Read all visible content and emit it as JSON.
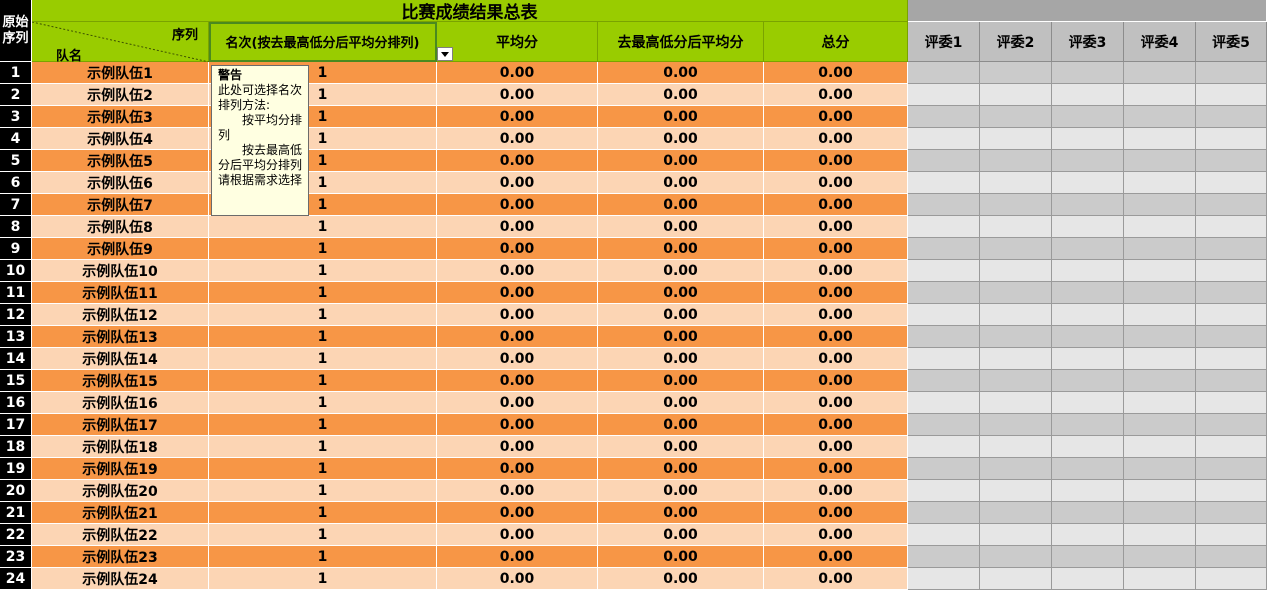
{
  "sheet": {
    "title": "比赛成绩结果总表",
    "corner_label": "原始序列",
    "diag_top": "序列",
    "diag_bottom": "队名",
    "headers": {
      "rank": "名次(按去最高低分后平均分排列)",
      "avg": "平均分",
      "trim_avg": "去最高低分后平均分",
      "total": "总分",
      "judges": [
        "评委1",
        "评委2",
        "评委3",
        "评委4",
        "评委5"
      ]
    },
    "tooltip": {
      "title": "警告",
      "lines": [
        "此处可选择名次排列方法:",
        "　　按平均分排列",
        "　　按去最高低分后平均分排列",
        "请根据需求选择"
      ]
    },
    "rows": [
      {
        "num": "1",
        "team": "示例队伍1",
        "rank": "1",
        "avg": "0.00",
        "trim": "0.00",
        "total": "0.00"
      },
      {
        "num": "2",
        "team": "示例队伍2",
        "rank": "1",
        "avg": "0.00",
        "trim": "0.00",
        "total": "0.00"
      },
      {
        "num": "3",
        "team": "示例队伍3",
        "rank": "1",
        "avg": "0.00",
        "trim": "0.00",
        "total": "0.00"
      },
      {
        "num": "4",
        "team": "示例队伍4",
        "rank": "1",
        "avg": "0.00",
        "trim": "0.00",
        "total": "0.00"
      },
      {
        "num": "5",
        "team": "示例队伍5",
        "rank": "1",
        "avg": "0.00",
        "trim": "0.00",
        "total": "0.00"
      },
      {
        "num": "6",
        "team": "示例队伍6",
        "rank": "1",
        "avg": "0.00",
        "trim": "0.00",
        "total": "0.00"
      },
      {
        "num": "7",
        "team": "示例队伍7",
        "rank": "1",
        "avg": "0.00",
        "trim": "0.00",
        "total": "0.00"
      },
      {
        "num": "8",
        "team": "示例队伍8",
        "rank": "1",
        "avg": "0.00",
        "trim": "0.00",
        "total": "0.00"
      },
      {
        "num": "9",
        "team": "示例队伍9",
        "rank": "1",
        "avg": "0.00",
        "trim": "0.00",
        "total": "0.00"
      },
      {
        "num": "10",
        "team": "示例队伍10",
        "rank": "1",
        "avg": "0.00",
        "trim": "0.00",
        "total": "0.00"
      },
      {
        "num": "11",
        "team": "示例队伍11",
        "rank": "1",
        "avg": "0.00",
        "trim": "0.00",
        "total": "0.00"
      },
      {
        "num": "12",
        "team": "示例队伍12",
        "rank": "1",
        "avg": "0.00",
        "trim": "0.00",
        "total": "0.00"
      },
      {
        "num": "13",
        "team": "示例队伍13",
        "rank": "1",
        "avg": "0.00",
        "trim": "0.00",
        "total": "0.00"
      },
      {
        "num": "14",
        "team": "示例队伍14",
        "rank": "1",
        "avg": "0.00",
        "trim": "0.00",
        "total": "0.00"
      },
      {
        "num": "15",
        "team": "示例队伍15",
        "rank": "1",
        "avg": "0.00",
        "trim": "0.00",
        "total": "0.00"
      },
      {
        "num": "16",
        "team": "示例队伍16",
        "rank": "1",
        "avg": "0.00",
        "trim": "0.00",
        "total": "0.00"
      },
      {
        "num": "17",
        "team": "示例队伍17",
        "rank": "1",
        "avg": "0.00",
        "trim": "0.00",
        "total": "0.00"
      },
      {
        "num": "18",
        "team": "示例队伍18",
        "rank": "1",
        "avg": "0.00",
        "trim": "0.00",
        "total": "0.00"
      },
      {
        "num": "19",
        "team": "示例队伍19",
        "rank": "1",
        "avg": "0.00",
        "trim": "0.00",
        "total": "0.00"
      },
      {
        "num": "20",
        "team": "示例队伍20",
        "rank": "1",
        "avg": "0.00",
        "trim": "0.00",
        "total": "0.00"
      },
      {
        "num": "21",
        "team": "示例队伍21",
        "rank": "1",
        "avg": "0.00",
        "trim": "0.00",
        "total": "0.00"
      },
      {
        "num": "22",
        "team": "示例队伍22",
        "rank": "1",
        "avg": "0.00",
        "trim": "0.00",
        "total": "0.00"
      },
      {
        "num": "23",
        "team": "示例队伍23",
        "rank": "1",
        "avg": "0.00",
        "trim": "0.00",
        "total": "0.00"
      },
      {
        "num": "24",
        "team": "示例队伍24",
        "rank": "1",
        "avg": "0.00",
        "trim": "0.00",
        "total": "0.00"
      }
    ],
    "colors": {
      "header_green": "#99cc00",
      "row_dark": "#f79646",
      "row_light": "#fcd5b4",
      "judge_dark": "#cbcbcb",
      "judge_light": "#e6e6e6",
      "index_column": "#000000"
    }
  }
}
